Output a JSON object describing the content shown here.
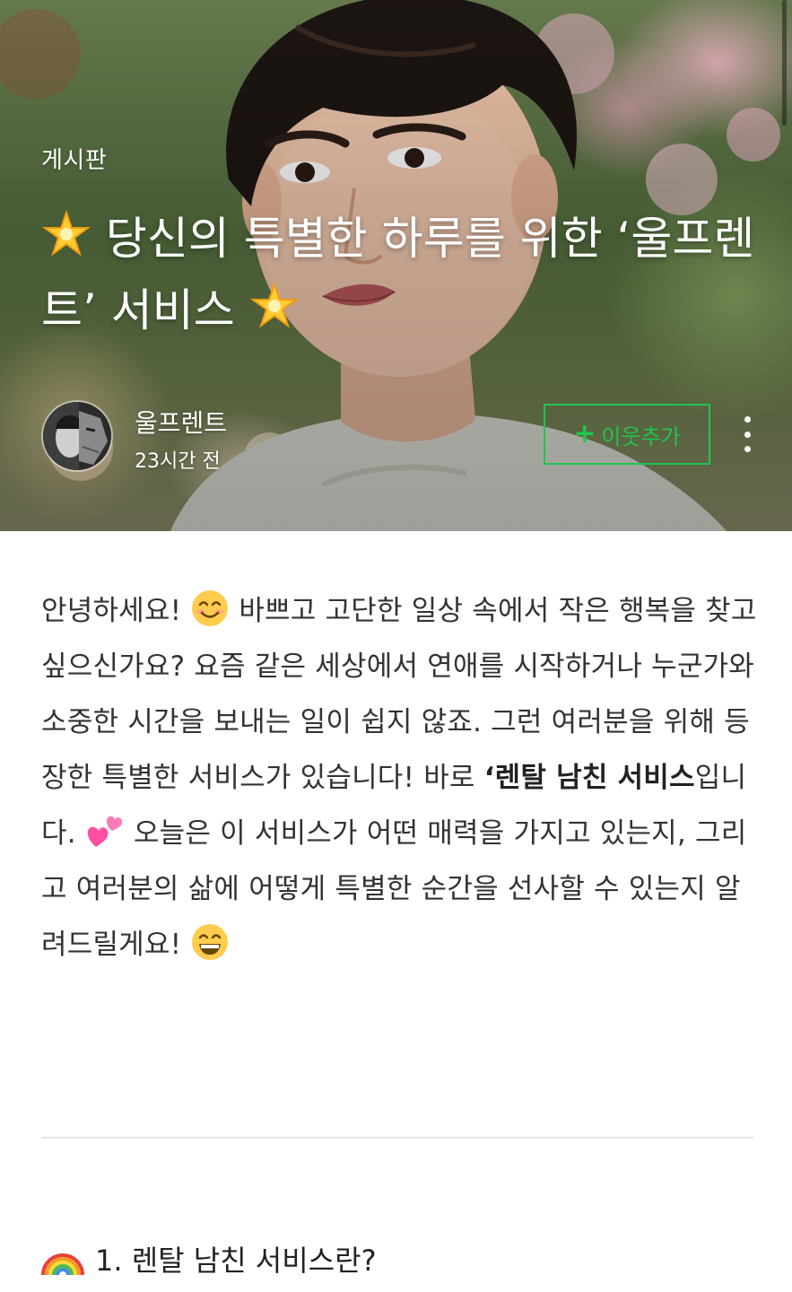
{
  "post": {
    "category": "게시판",
    "title_part1": "당신의 특별한 하루를 위한 ‘울프렌트’ 서비스",
    "author": "울프렌트",
    "time": "23시간 전",
    "add_neighbor_label": "이웃추가"
  },
  "intro": {
    "s1": "안녕하세요! ",
    "s2": " 바쁘고 고단한 일상 속에서 작은 행복을 찾고 싶으신가요? 요즘 같은 세상에서 연애를 시작하거나 누군가와 소중한 시간을 보내는 일이 쉽지 않죠. 그런 여러분을 위해 등장한 특별한 서비스가 있습니다! 바로 ",
    "bold": "‘렌탈 남친 서비스",
    "s3": "입니다. ",
    "s4": " 오늘은 이 서비스가 어떤 매력을 가지고 있는지, 그리고 여러분의 삶에 어떻게 특별한 순간을 선사할 수 있는지 알려드릴게요! "
  },
  "section1": {
    "heading": "1. 렌탈 남친 서비스란?"
  },
  "icons": [
    "star-icon",
    "smile-icon",
    "hearts-icon",
    "grin-icon",
    "rainbow-icon",
    "plus-icon",
    "more-icon"
  ],
  "colors": {
    "accent": "#20c54c",
    "text": "#333333",
    "divider": "#e6e6e6"
  }
}
